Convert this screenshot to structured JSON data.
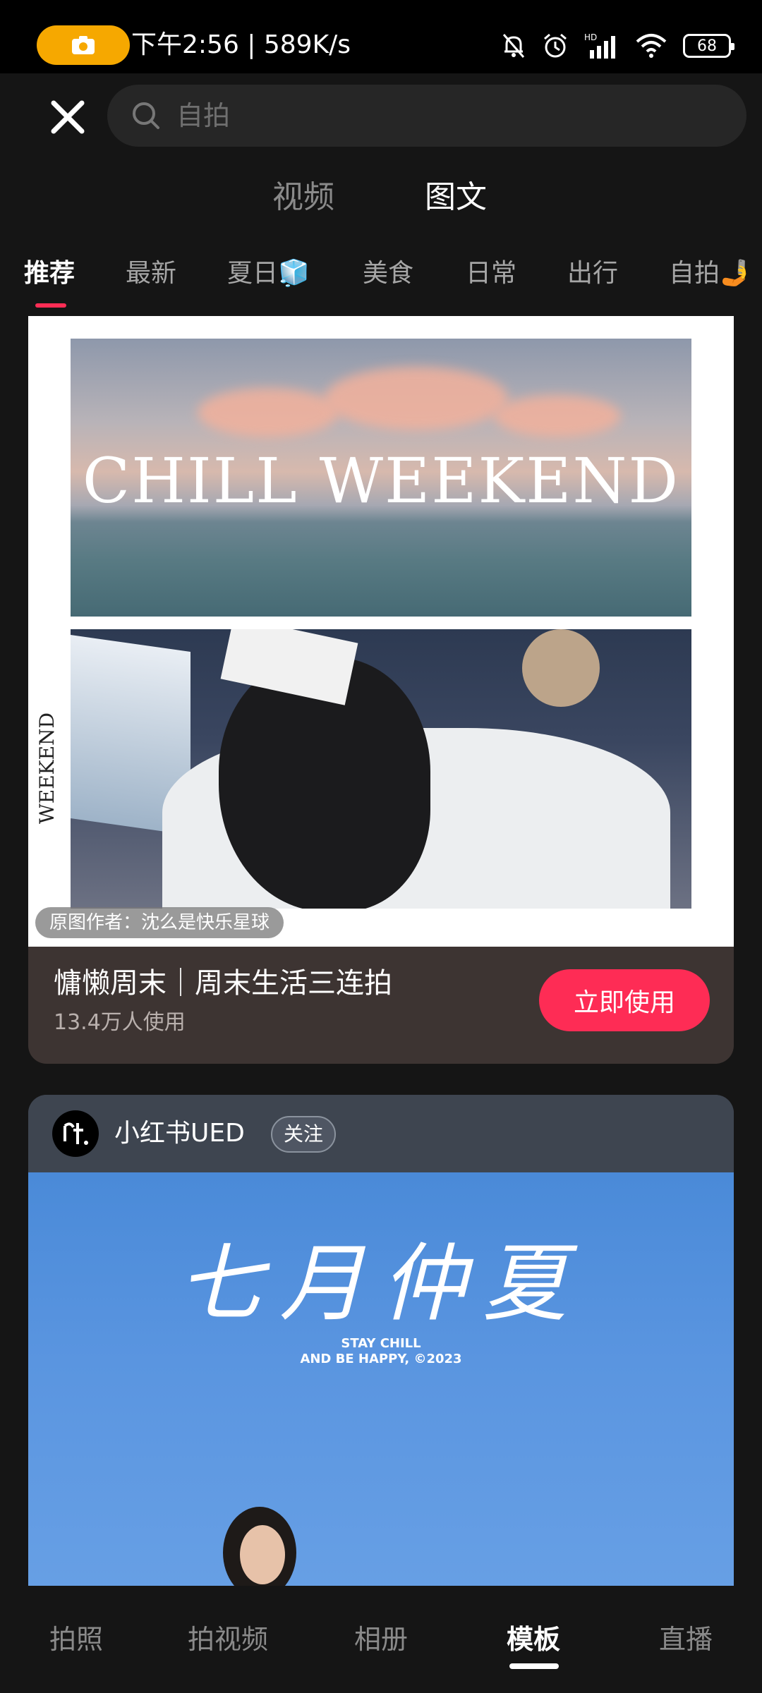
{
  "status_bar": {
    "time_speed": "下午2:56 | 589K/s",
    "battery": "68",
    "icons": [
      "camera-icon",
      "bell-off-icon",
      "alarm-icon",
      "signal-icon",
      "wifi-icon",
      "battery-icon"
    ]
  },
  "search": {
    "placeholder": "自拍"
  },
  "mode_tabs": {
    "video": "视频",
    "image": "图文",
    "selected": "图文"
  },
  "categories": [
    "推荐",
    "最新",
    "夏日🧊",
    "美食",
    "日常",
    "出行",
    "自拍🤳"
  ],
  "category_selected": "推荐",
  "card1": {
    "image_text": "CHILL WEEKEND",
    "side_text": "WEEKEND",
    "credit": "原图作者：沈么是快乐星球",
    "title": "慵懒周末｜周末生活三连拍",
    "users": "13.4万人使用",
    "use_button": "立即使用"
  },
  "card2": {
    "author": "小红书UED",
    "follow": "关注",
    "headline": "七月仲夏",
    "tagline_1": "STAY CHILL",
    "tagline_2": "AND BE HAPPY, ©2023"
  },
  "bottom_nav": {
    "items": [
      "拍照",
      "拍视频",
      "相册",
      "模板",
      "直播"
    ],
    "selected": "模板"
  },
  "colors": {
    "accent": "#fe2c55",
    "background": "#151515",
    "status_camera": "#f6a800"
  }
}
